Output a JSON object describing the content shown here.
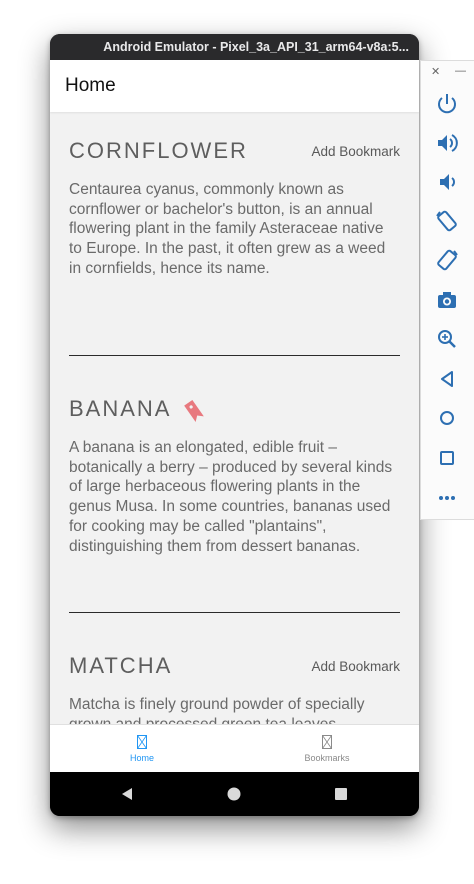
{
  "window": {
    "title": "Android Emulator - Pixel_3a_API_31_arm64-v8a:5..."
  },
  "app": {
    "title": "Home"
  },
  "cards": [
    {
      "title": "CORNFLOWER",
      "bookmark_label": "Add Bookmark",
      "bookmarked": false,
      "description": "Centaurea cyanus, commonly known as cornflower or bachelor's button, is an annual flowering plant in the family Asteraceae native to Europe. In the past, it often grew as a weed in cornfields, hence its name."
    },
    {
      "title": "BANANA",
      "bookmark_label": "",
      "bookmarked": true,
      "bookmark_icon": "bookmark-icon",
      "description": "A banana is an elongated, edible fruit – botanically a berry – produced by several kinds of large herbaceous flowering plants in the genus Musa. In some countries, bananas used for cooking may be called \"plantains\", distinguishing them from dessert bananas."
    },
    {
      "title": "MATCHA",
      "bookmark_label": "Add Bookmark",
      "bookmarked": false,
      "description": "Matcha is finely ground powder of specially grown and processed green tea leaves, traditionally consumed in East Asia. The"
    }
  ],
  "bottom_nav": {
    "items": [
      {
        "label": "Home",
        "active": true,
        "icon": "home-tab-icon"
      },
      {
        "label": "Bookmarks",
        "active": false,
        "icon": "bookmarks-tab-icon"
      }
    ]
  },
  "system_nav": {
    "icons": [
      "back-icon",
      "home-icon",
      "recents-icon"
    ]
  },
  "emulator_toolbar": {
    "icons": [
      "close-icon",
      "minimize-icon",
      "power-icon",
      "volume-up-icon",
      "volume-down-icon",
      "rotate-left-icon",
      "rotate-right-icon",
      "camera-icon",
      "zoom-icon",
      "back-icon",
      "home-icon",
      "overview-icon",
      "more-icon"
    ]
  },
  "colors": {
    "accent": "#2196f3",
    "bookmark": "#e8797f",
    "screen_bg": "#f2f2f2",
    "text": "#6a6a6a"
  }
}
